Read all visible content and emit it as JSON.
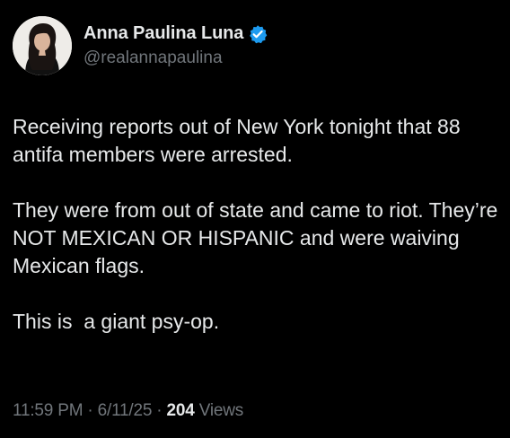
{
  "author": {
    "display_name": "Anna Paulina Luna",
    "handle": "@realannapaulina",
    "verified_badge": "verified-check-icon",
    "badge_color": "#1d9bf0"
  },
  "tweet": {
    "paragraphs": [
      "Receiving reports out of New York tonight that 88 antifa members were arrested.",
      "They were from out of state and came to riot. They’re NOT MEXICAN OR HISPANIC and were waiving Mexican flags.",
      "This is  a giant psy-op."
    ]
  },
  "meta": {
    "time": "11:59 PM",
    "separator": " · ",
    "date": "6/11/25",
    "views_count": "204",
    "views_label": "Views"
  },
  "colors": {
    "background": "#000000",
    "primary_text": "#e7e9ea",
    "secondary_text": "#71767b"
  }
}
